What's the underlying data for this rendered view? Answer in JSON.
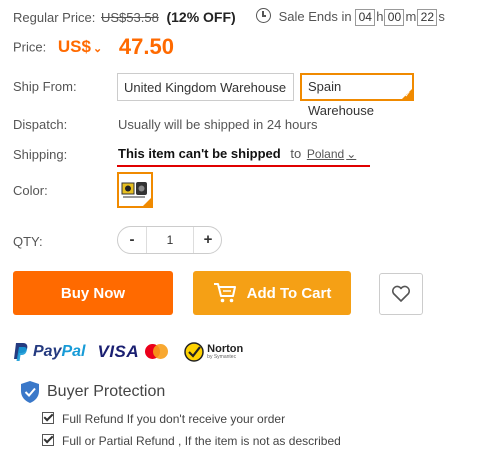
{
  "price": {
    "regular_label": "Regular Price:",
    "regular_value": "US$53.58",
    "discount": "(12% OFF)",
    "sale_ends_label": "Sale Ends in",
    "timer": {
      "h_value": "04",
      "h_unit": "h",
      "m_value": "00",
      "m_unit": "m",
      "s_value": "22",
      "s_unit": "s"
    },
    "price_label": "Price:",
    "currency": "US$",
    "amount": "47.50"
  },
  "ship_from": {
    "label": "Ship From:",
    "options": [
      "United Kingdom Warehouse",
      "Spain Warehouse"
    ],
    "selected": "Spain Warehouse"
  },
  "dispatch": {
    "label": "Dispatch:",
    "value": "Usually will be shipped in 24 hours"
  },
  "shipping": {
    "label": "Shipping:",
    "message": "This item can't be shipped",
    "to": "to",
    "country": "Poland"
  },
  "color": {
    "label": "Color:"
  },
  "qty": {
    "label": "QTY:",
    "minus": "-",
    "value": "1",
    "plus": "+"
  },
  "actions": {
    "buy_now": "Buy Now",
    "add_to_cart": "Add To Cart"
  },
  "payments": {
    "paypal_p1": "Pay",
    "paypal_p2": "Pal",
    "visa": "VISA",
    "norton": "Norton",
    "norton_sub": "by Symantec"
  },
  "protection": {
    "title": "Buyer Protection",
    "items": [
      "Full Refund If you don't receive your order",
      "Full or Partial Refund , If the item is not as described"
    ]
  },
  "colors": {
    "accent": "#f08a00",
    "buy_now": "#ff6a00",
    "add_to_cart": "#f5a015",
    "price": "#ff6a00",
    "error_line": "#e00000"
  }
}
